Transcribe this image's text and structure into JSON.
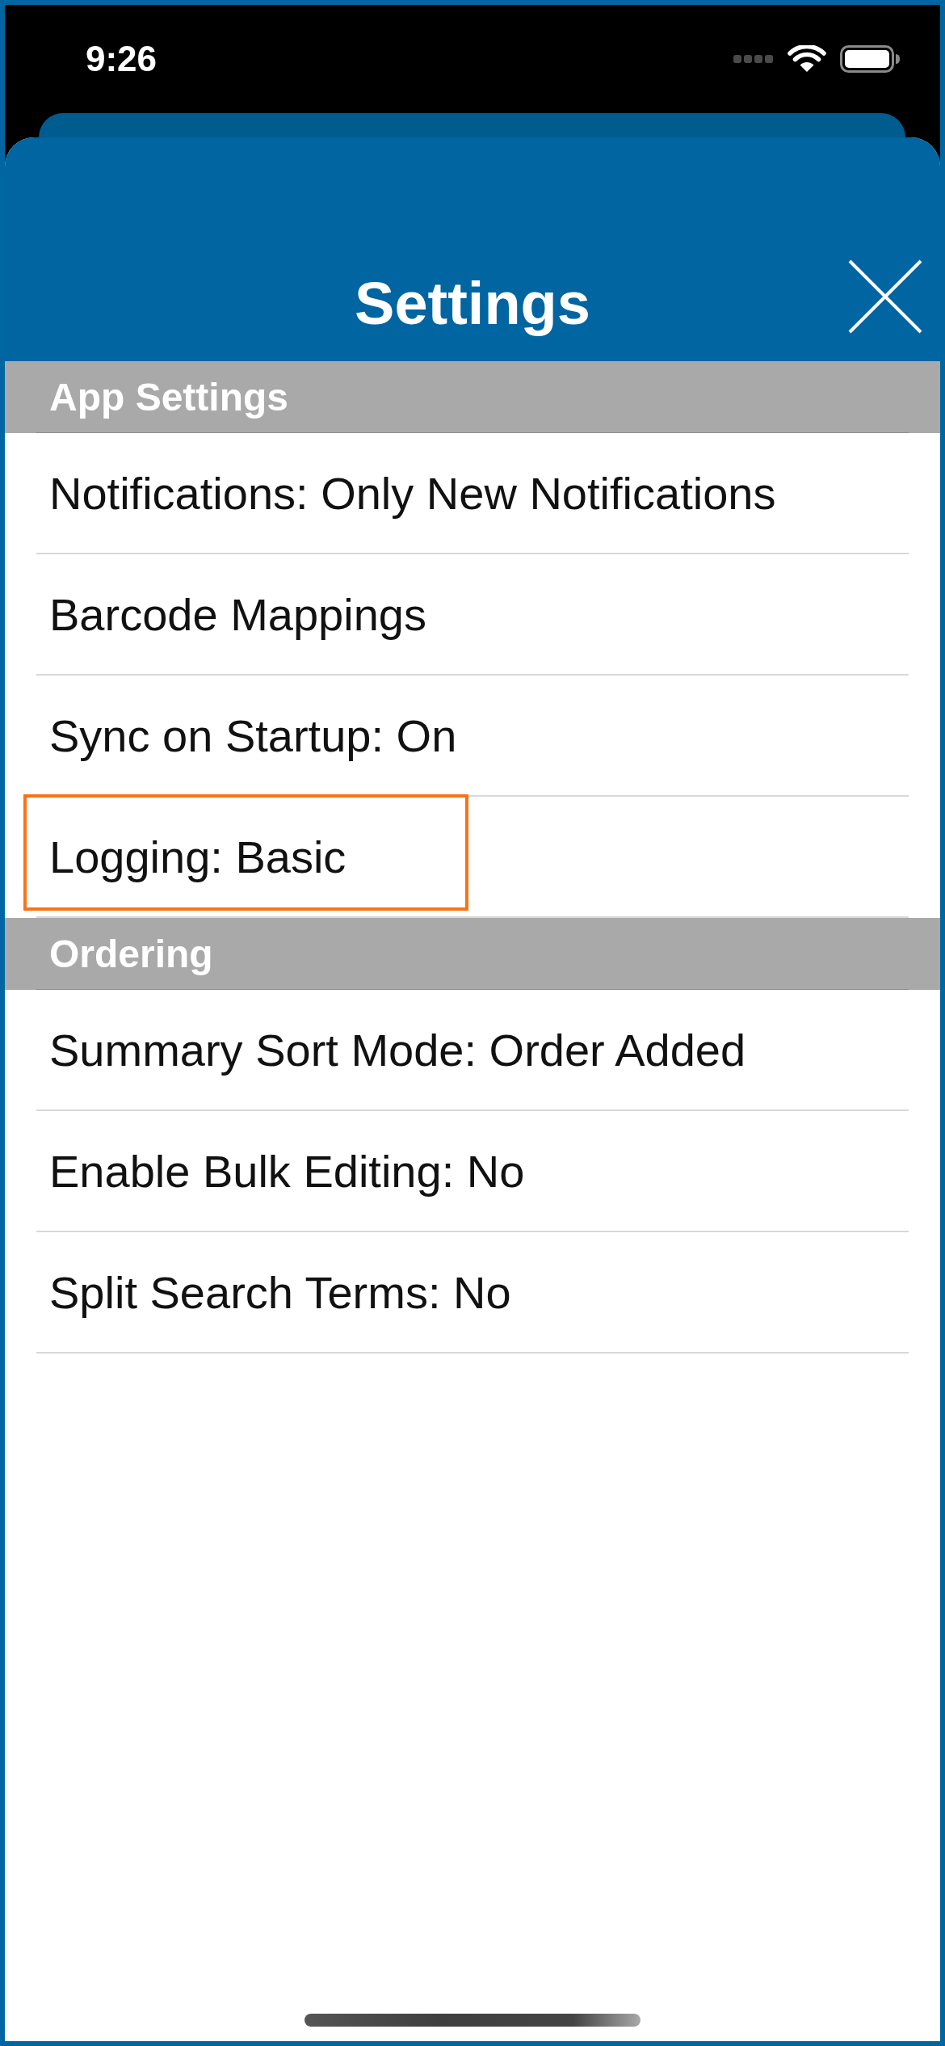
{
  "status_bar": {
    "time": "9:26"
  },
  "header": {
    "title": "Settings"
  },
  "sections": [
    {
      "title": "App Settings",
      "items": [
        {
          "label": "Notifications: Only New Notifications",
          "highlighted": false
        },
        {
          "label": "Barcode Mappings",
          "highlighted": false
        },
        {
          "label": "Sync on Startup: On",
          "highlighted": false
        },
        {
          "label": "Logging: Basic",
          "highlighted": true
        }
      ]
    },
    {
      "title": "Ordering",
      "items": [
        {
          "label": "Summary Sort Mode: Order Added",
          "highlighted": false
        },
        {
          "label": "Enable Bulk Editing: No",
          "highlighted": false
        },
        {
          "label": "Split Search Terms: No",
          "highlighted": false
        }
      ]
    }
  ]
}
